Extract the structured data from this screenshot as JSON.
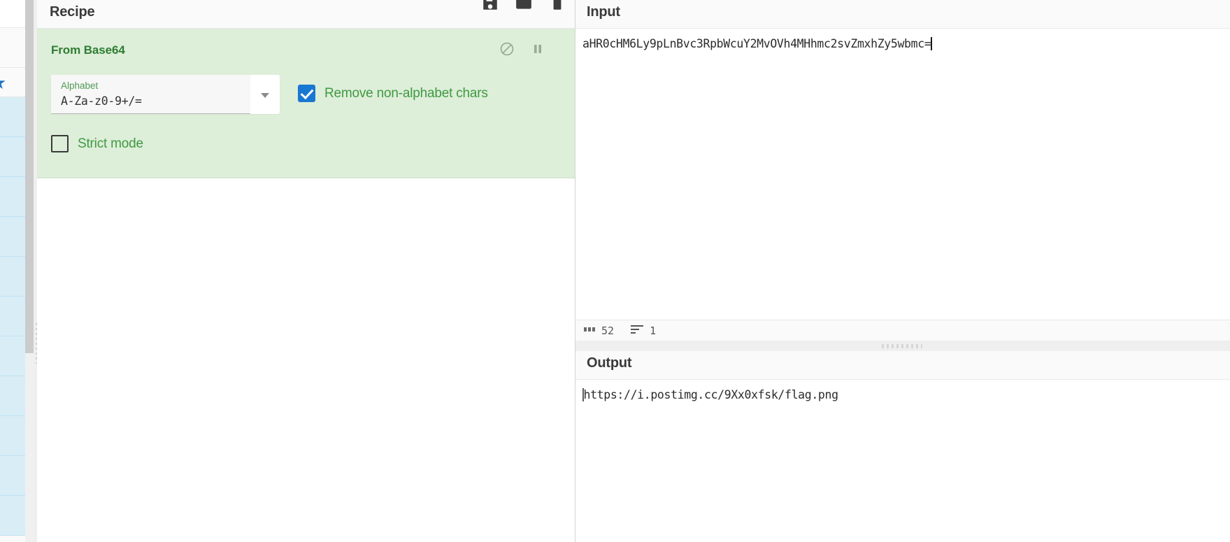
{
  "operations_panel": {
    "favourites_star_icon": "star-icon",
    "category_rows": 11
  },
  "recipe": {
    "title": "Recipe",
    "controls": [
      {
        "name": "save-recipe-button",
        "icon": "save-icon",
        "label": "Save recipe"
      },
      {
        "name": "load-recipe-button",
        "icon": "folder-icon",
        "label": "Load recipe"
      },
      {
        "name": "clear-recipe-button",
        "icon": "bin-icon",
        "label": "Clear recipe"
      }
    ],
    "operations": [
      {
        "name": "From Base64",
        "disable_icon": "disable-icon",
        "breakpoint_icon": "pause-icon",
        "args": {
          "alphabet": {
            "label": "Alphabet",
            "value": "A-Za-z0-9+/="
          },
          "remove_non_alphabet": {
            "label": "Remove non-alphabet chars",
            "checked": true
          },
          "strict_mode": {
            "label": "Strict mode",
            "checked": false
          }
        }
      }
    ]
  },
  "input": {
    "title": "Input",
    "value": "aHR0cHM6Ly9pLnBvc3RpbWcuY2MvOVh4MHhmc2svZmxhZy5wbmc=",
    "status": {
      "length_icon": "abc-icon",
      "length": "52",
      "lines_icon": "lines-icon",
      "lines": "1"
    }
  },
  "output": {
    "title": "Output",
    "value": "https://i.postimg.cc/9Xx0xfsk/flag.png"
  },
  "colors": {
    "operation_bg": "#ddeed9",
    "operation_title": "#2e7d32",
    "checkbox_checked": "#1877d2",
    "arg_label": "#4f9a52",
    "panel_header_bg": "#fafafa",
    "category_row": "#d9edf7",
    "star": "#1a74c4"
  }
}
